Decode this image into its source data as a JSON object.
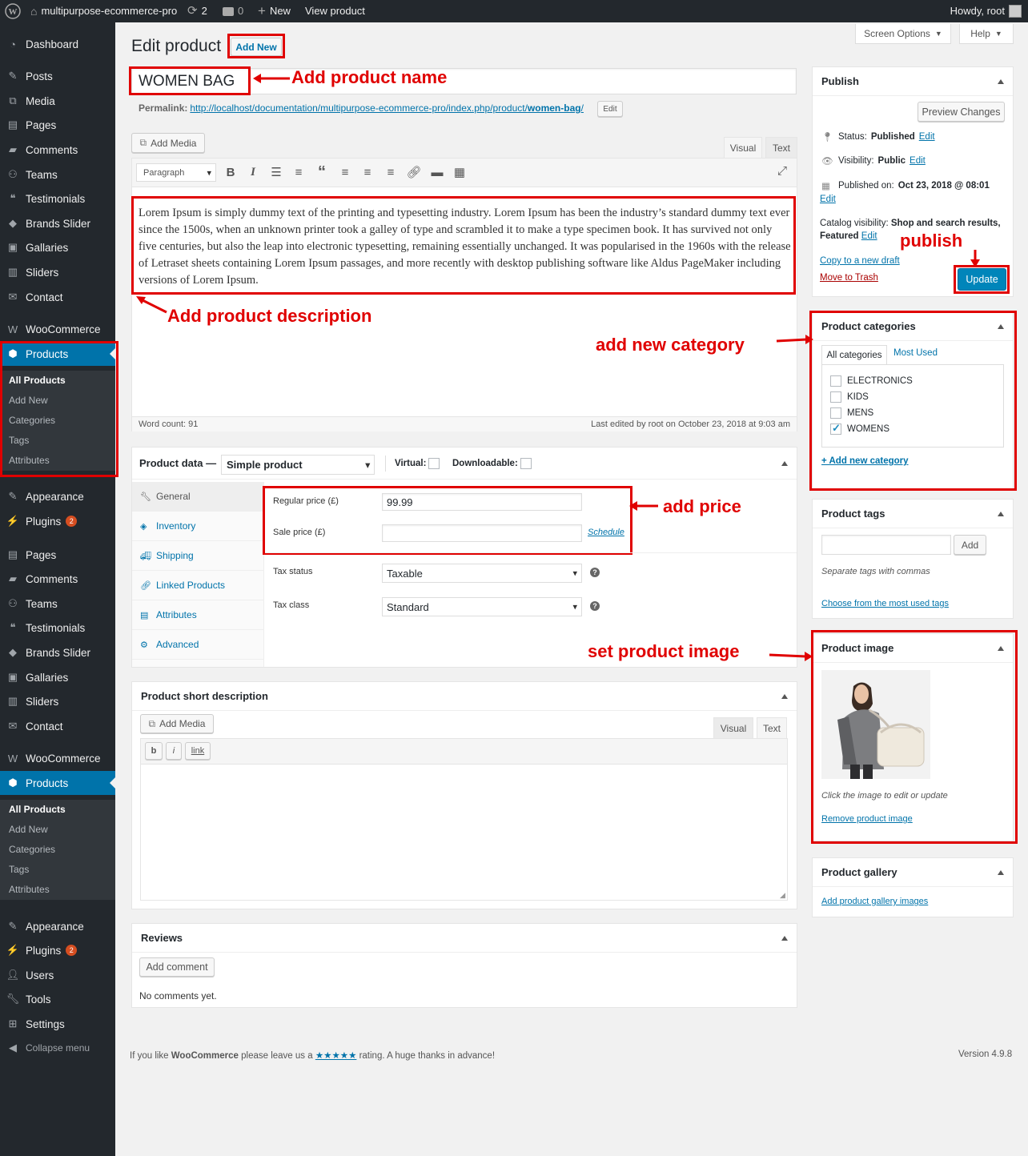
{
  "admin_bar": {
    "site": "multipurpose-ecommerce-pro",
    "updates": "2",
    "comments": "0",
    "new": "New",
    "view": "View product",
    "howdy": "Howdy, root"
  },
  "sidebar": {
    "group1": [
      {
        "label": "Dashboard",
        "icon": "dashboard-icon"
      },
      {
        "label": "Posts",
        "icon": "pin-icon"
      },
      {
        "label": "Media",
        "icon": "media-icon"
      },
      {
        "label": "Pages",
        "icon": "pages-icon"
      },
      {
        "label": "Comments",
        "icon": "comments-icon"
      },
      {
        "label": "Teams",
        "icon": "teams-icon"
      },
      {
        "label": "Testimonials",
        "icon": "testimonials-icon"
      },
      {
        "label": "Brands Slider",
        "icon": "brands-icon"
      },
      {
        "label": "Gallaries",
        "icon": "gallery-icon"
      },
      {
        "label": "Sliders",
        "icon": "sliders-icon"
      },
      {
        "label": "Contact",
        "icon": "mail-icon"
      },
      {
        "label": "WooCommerce",
        "icon": "woo-icon"
      },
      {
        "label": "Products",
        "icon": "products-icon"
      }
    ],
    "submenu": [
      "All Products",
      "Add New",
      "Categories",
      "Tags",
      "Attributes"
    ],
    "group2": [
      {
        "label": "Appearance",
        "icon": "brush-icon"
      },
      {
        "label": "Plugins",
        "icon": "plugin-icon",
        "badge": "2"
      }
    ],
    "group3": [
      {
        "label": "Pages",
        "icon": "pages-icon"
      },
      {
        "label": "Comments",
        "icon": "comments-icon"
      },
      {
        "label": "Teams",
        "icon": "teams-icon"
      },
      {
        "label": "Testimonials",
        "icon": "testimonials-icon"
      },
      {
        "label": "Brands Slider",
        "icon": "brands-icon"
      },
      {
        "label": "Gallaries",
        "icon": "gallery-icon"
      },
      {
        "label": "Sliders",
        "icon": "sliders-icon"
      },
      {
        "label": "Contact",
        "icon": "mail-icon"
      },
      {
        "label": "WooCommerce",
        "icon": "woo-icon"
      },
      {
        "label": "Products",
        "icon": "products-icon"
      }
    ],
    "group4": [
      {
        "label": "Appearance",
        "icon": "brush-icon"
      },
      {
        "label": "Plugins",
        "icon": "plugin-icon",
        "badge": "2"
      },
      {
        "label": "Users",
        "icon": "users-icon"
      },
      {
        "label": "Tools",
        "icon": "tools-icon"
      },
      {
        "label": "Settings",
        "icon": "settings-icon"
      }
    ],
    "collapse": "Collapse menu"
  },
  "header": {
    "title": "Edit product",
    "add_new": "Add New",
    "screen_options": "Screen Options",
    "help": "Help"
  },
  "product": {
    "name": "WOMEN BAG",
    "permalink_label": "Permalink:",
    "permalink_url": "http://localhost/documentation/multipurpose-ecommerce-pro/index.php/product/",
    "permalink_slug": "women-bag",
    "permalink_tail": "/",
    "edit": "Edit"
  },
  "editor": {
    "add_media": "Add Media",
    "tab_visual": "Visual",
    "tab_text": "Text",
    "format": "Paragraph",
    "content": "Lorem Ipsum is simply dummy text of the printing and typesetting industry. Lorem Ipsum has been the industry’s standard dummy text ever since the 1500s, when an unknown printer took a galley of type and scrambled it to make a type specimen book. It has survived not only five centuries, but also the leap into electronic typesetting, remaining essentially unchanged. It was popularised in the 1960s with the release of Letraset sheets containing Lorem Ipsum passages, and more recently with desktop publishing software like Aldus PageMaker including versions of Lorem Ipsum.",
    "word_count": "Word count: 91",
    "last_edited": "Last edited by root on October 23, 2018 at 9:03 am"
  },
  "product_data": {
    "label": "Product data —",
    "type": "Simple product",
    "virtual": "Virtual:",
    "downloadable": "Downloadable:",
    "tabs": [
      {
        "label": "General",
        "icon": "wrench-icon"
      },
      {
        "label": "Inventory",
        "icon": "tag-icon"
      },
      {
        "label": "Shipping",
        "icon": "truck-icon"
      },
      {
        "label": "Linked Products",
        "icon": "link-icon"
      },
      {
        "label": "Attributes",
        "icon": "list-icon"
      },
      {
        "label": "Advanced",
        "icon": "gear-icon"
      }
    ],
    "regular_price_label": "Regular price (£)",
    "regular_price": "99.99",
    "sale_price_label": "Sale price (£)",
    "sale_price": "",
    "schedule": "Schedule",
    "tax_status_label": "Tax status",
    "tax_status": "Taxable",
    "tax_class_label": "Tax class",
    "tax_class": "Standard"
  },
  "short_desc": {
    "title": "Product short description",
    "add_media": "Add Media",
    "tab_visual": "Visual",
    "tab_text": "Text",
    "b": "b",
    "i": "i",
    "link": "link"
  },
  "reviews": {
    "title": "Reviews",
    "add_comment": "Add comment",
    "none": "No comments yet."
  },
  "publish": {
    "title": "Publish",
    "preview": "Preview Changes",
    "status_label": "Status:",
    "status": "Published",
    "visibility_label": "Visibility:",
    "visibility": "Public",
    "published_label": "Published on:",
    "published": "Oct 23, 2018 @ 08:01",
    "catalog_label": "Catalog visibility:",
    "catalog": "Shop and search results, Featured",
    "edit": "Edit",
    "copy": "Copy to a new draft",
    "trash": "Move to Trash",
    "update": "Update"
  },
  "categories": {
    "title": "Product categories",
    "tab_all": "All categories",
    "tab_most": "Most Used",
    "items": [
      {
        "label": "ELECTRONICS",
        "checked": false
      },
      {
        "label": "KIDS",
        "checked": false
      },
      {
        "label": "MENS",
        "checked": false
      },
      {
        "label": "WOMENS",
        "checked": true
      }
    ],
    "add_new": "+ Add new category"
  },
  "tags": {
    "title": "Product tags",
    "add": "Add",
    "hint": "Separate tags with commas",
    "choose": "Choose from the most used tags"
  },
  "image": {
    "title": "Product image",
    "hint": "Click the image to edit or update",
    "remove": "Remove product image"
  },
  "gallery": {
    "title": "Product gallery",
    "add": "Add product gallery images"
  },
  "annotations": {
    "name": "Add product name",
    "description": "Add product description",
    "category": "add new category",
    "publish": "publish",
    "price": "add price",
    "image": "set product image"
  },
  "footer": {
    "pre": "If you like ",
    "woo": "WooCommerce",
    "mid": " please leave us a ",
    "stars": "★★★★★",
    "post": " rating. A huge thanks in advance!",
    "version": "Version 4.9.8"
  },
  "colors": {
    "accent": "#0073aa",
    "annotation": "#e00000",
    "sidebar": "#23282d"
  }
}
